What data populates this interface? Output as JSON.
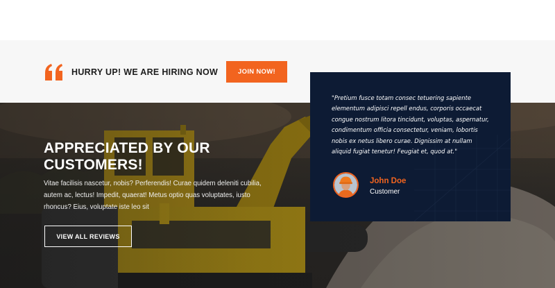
{
  "hiring": {
    "text": "HURRY UP! WE ARE HIRING NOW",
    "join_label": "JOIN NOW!"
  },
  "hero": {
    "title": "APPRECIATED BY OUR CUSTOMERS!",
    "description": "Vitae facilisis nascetur, nobis? Perferendis! Curae quidem deleniti cubilia, autem ac, lectus! Impedit, quaerat! Metus optio quas voluptates, iusto rhoncus? Eius, voluptate iste leo sit",
    "reviews_label": "VIEW ALL REVIEWS"
  },
  "testimonial": {
    "quote": "\"Pretium fusce totam consec tetuering sapiente elementum adipisci repell endus, corporis occaecat congue nostrum litora tincidunt, voluptas, aspernatur, condimentum officia consectetur, veniam, lobortis nobis ex netus libero curae. Dignissim at nullam aliquid fugiat tenetur! Feugiat et, quod at.\"",
    "author_name": "John Doe",
    "author_role": "Customer"
  },
  "colors": {
    "accent": "#f2641f",
    "panel": "#0d1b34"
  },
  "icons": {
    "quote": "quote-icon",
    "avatar": "worker-avatar"
  }
}
